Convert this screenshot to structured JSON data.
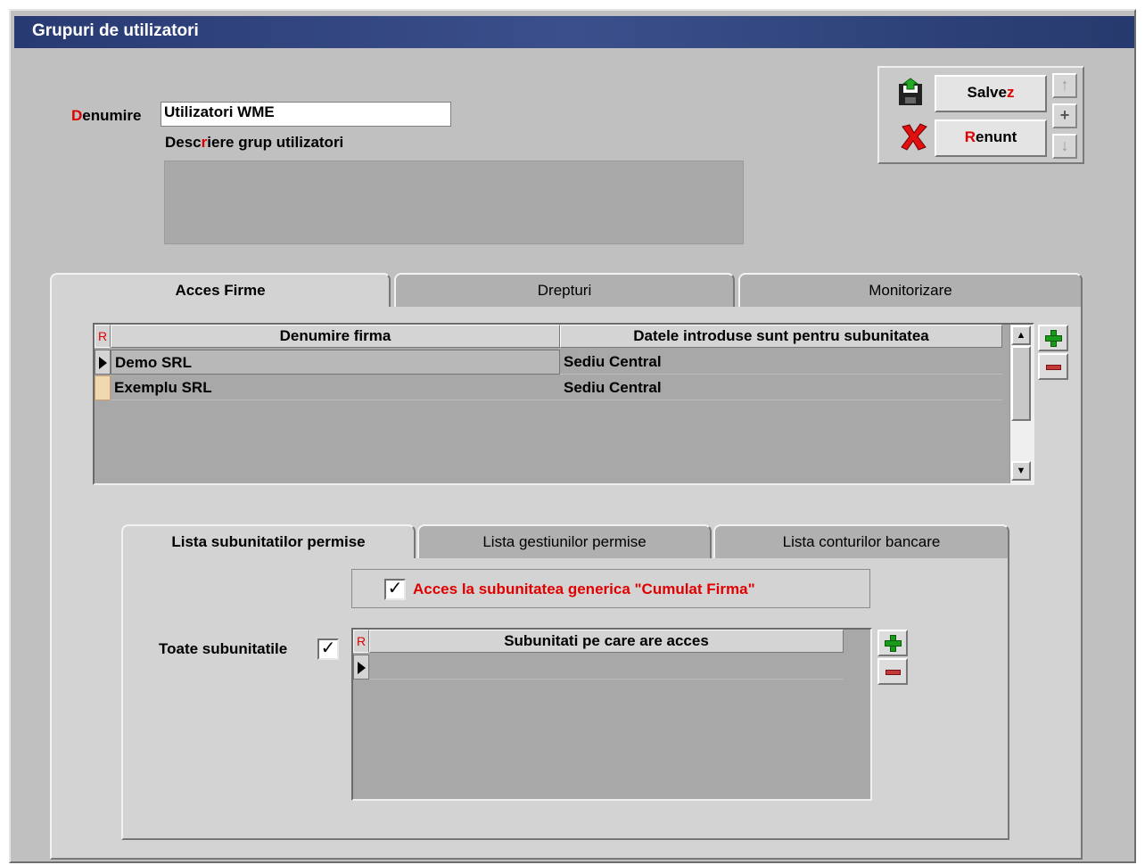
{
  "window": {
    "title": "Grupuri de utilizatori"
  },
  "form": {
    "denumire_label_hot": "D",
    "denumire_label_rest": "enumire",
    "denumire_value": "Utilizatori WME",
    "descriere_label_a": "Desc",
    "descriere_label_hot": "r",
    "descriere_label_b": "iere grup utilizatori",
    "descriere_value": ""
  },
  "actions": {
    "save_label_a": "Salve",
    "save_label_hot": "z",
    "cancel_label_hot": "R",
    "cancel_label_b": "enunt",
    "nav_up": "↑",
    "nav_add": "+",
    "nav_down": "↓"
  },
  "tabs": [
    {
      "label": "Acces Firme",
      "active": true
    },
    {
      "label": "Drepturi",
      "active": false
    },
    {
      "label": "Monitorizare",
      "active": false
    }
  ],
  "firms_grid": {
    "r_header": "R",
    "columns": [
      "Denumire firma",
      "Datele introduse sunt pentru subunitatea"
    ],
    "rows": [
      {
        "firma": "Demo SRL",
        "subunitate": "Sediu Central",
        "current": true
      },
      {
        "firma": "Exemplu SRL",
        "subunitate": "Sediu Central",
        "current": false
      }
    ],
    "scroll_up": "▲",
    "scroll_down": "▼"
  },
  "subtabs": [
    {
      "label": "Lista subunitatilor permise",
      "active": true
    },
    {
      "label": "Lista gestiunilor permise",
      "active": false
    },
    {
      "label": "Lista conturilor bancare",
      "active": false
    }
  ],
  "subunits": {
    "generic_access_label": "Acces la subunitatea generica \"Cumulat Firma\"",
    "generic_access_checked": true,
    "all_label": "Toate subunitatile",
    "all_checked": true,
    "r_header": "R",
    "column": "Subunitati pe care are acces",
    "checkmark": "✓"
  },
  "colors": {
    "hotkey": "#e00000",
    "title_bar": "#2f4580",
    "window_bg": "#c0c0c0",
    "add_green": "#1a9a1a",
    "remove_red": "#c43a3a"
  }
}
